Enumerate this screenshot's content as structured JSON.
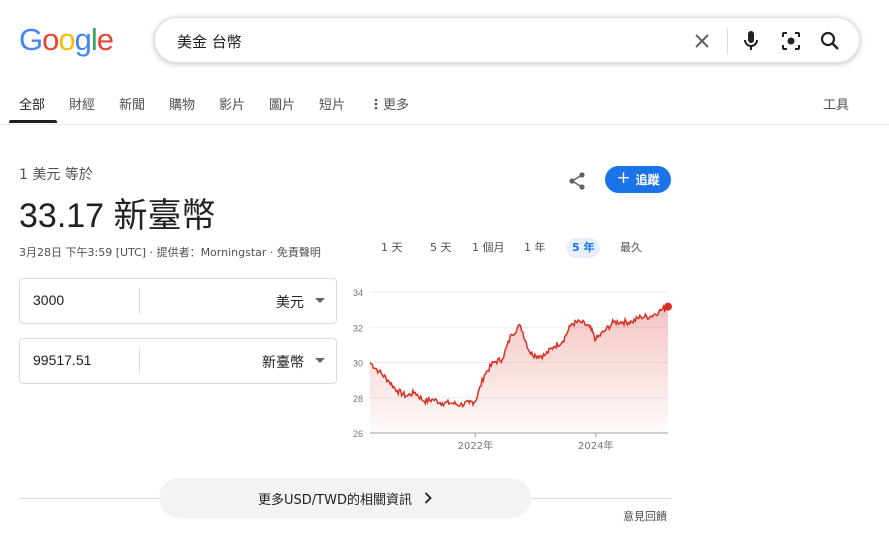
{
  "header": {
    "logo": [
      "G",
      "o",
      "o",
      "g",
      "l",
      "e"
    ],
    "logo_colors": [
      "#4285F4",
      "#EA4335",
      "#FBBC05",
      "#4285F4",
      "#34A853",
      "#EA4335"
    ],
    "search_query": "美金 台幣"
  },
  "tabs": {
    "items": [
      "全部",
      "財經",
      "新聞",
      "購物",
      "影片",
      "圖片",
      "短片",
      "更多"
    ],
    "tools": "工具"
  },
  "converter": {
    "label": "1 美元 等於",
    "result": "33.17 新臺幣",
    "meta": "3月28日 下午3:59 [UTC] · 提供者：Morningstar · 免責聲明",
    "follow_label": "追蹤",
    "ranges": [
      "1 天",
      "5 天",
      "1 個月",
      "1 年",
      "5 年",
      "最久"
    ],
    "active_range": "5 年",
    "from_value": "3000",
    "from_currency": "美元",
    "to_value": "99517.51",
    "to_currency": "新臺幣"
  },
  "chart_data": {
    "type": "area",
    "y_ticks": [
      "34",
      "32",
      "30",
      "28",
      "26"
    ],
    "ylim": [
      26,
      34
    ],
    "x_ticks": [
      "2022年",
      "2024年"
    ],
    "line_color": "#d93025",
    "series": [
      {
        "x": [
          2020.25,
          2020.4,
          2020.55,
          2020.7,
          2020.85,
          2021.0,
          2021.15,
          2021.3,
          2021.45,
          2021.6,
          2021.75,
          2021.9,
          2022.0,
          2022.15,
          2022.3,
          2022.45,
          2022.6,
          2022.75,
          2022.9,
          2023.0,
          2023.15,
          2023.3,
          2023.45,
          2023.6,
          2023.75,
          2023.9,
          2024.0,
          2024.15,
          2024.3,
          2024.45,
          2024.6,
          2024.75,
          2024.9,
          2025.05,
          2025.2
        ],
        "y": [
          30.0,
          29.5,
          29.0,
          28.4,
          28.1,
          28.3,
          27.8,
          27.9,
          27.7,
          27.7,
          27.6,
          27.7,
          27.8,
          29.3,
          30.0,
          30.2,
          31.6,
          32.1,
          30.6,
          30.4,
          30.4,
          30.9,
          31.2,
          32.2,
          32.3,
          32.0,
          31.3,
          31.8,
          32.3,
          32.3,
          32.3,
          32.6,
          32.6,
          32.9,
          33.17
        ]
      }
    ]
  },
  "footer": {
    "more_info": "更多USD/TWD的相關資訊",
    "feedback": "意見回饋"
  }
}
